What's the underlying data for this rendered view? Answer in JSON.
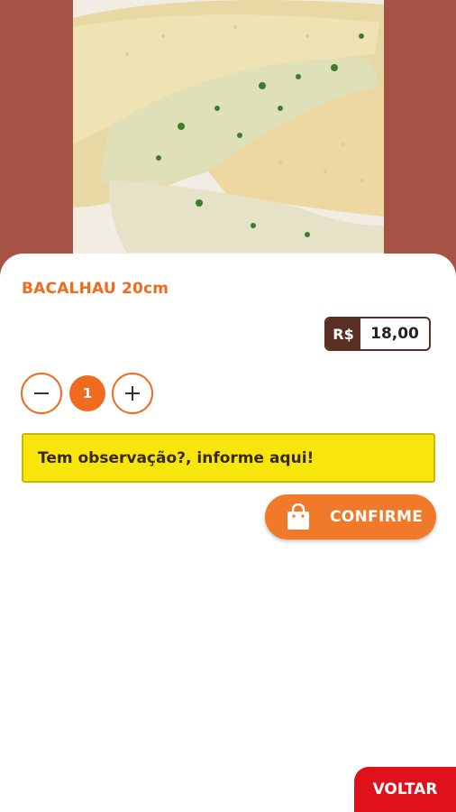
{
  "product": {
    "name": "BACALHAU 20cm",
    "image_icon": "pastel-photo"
  },
  "price": {
    "currency": "R$",
    "value": "18,00"
  },
  "quantity": {
    "value": "1",
    "minus_icon": "minus-icon",
    "plus_icon": "plus-icon"
  },
  "observation": {
    "placeholder": "Tem observação?, informe aqui!"
  },
  "actions": {
    "confirm_label": "CONFIRME",
    "confirm_icon": "shopping-bag-icon",
    "back_label": "VOLTAR"
  },
  "colors": {
    "background": "#a65345",
    "accent_orange": "#ef6b1f",
    "observation_yellow": "#f7e50c",
    "back_red": "#e0111b",
    "price_brown": "#5a2f24"
  }
}
